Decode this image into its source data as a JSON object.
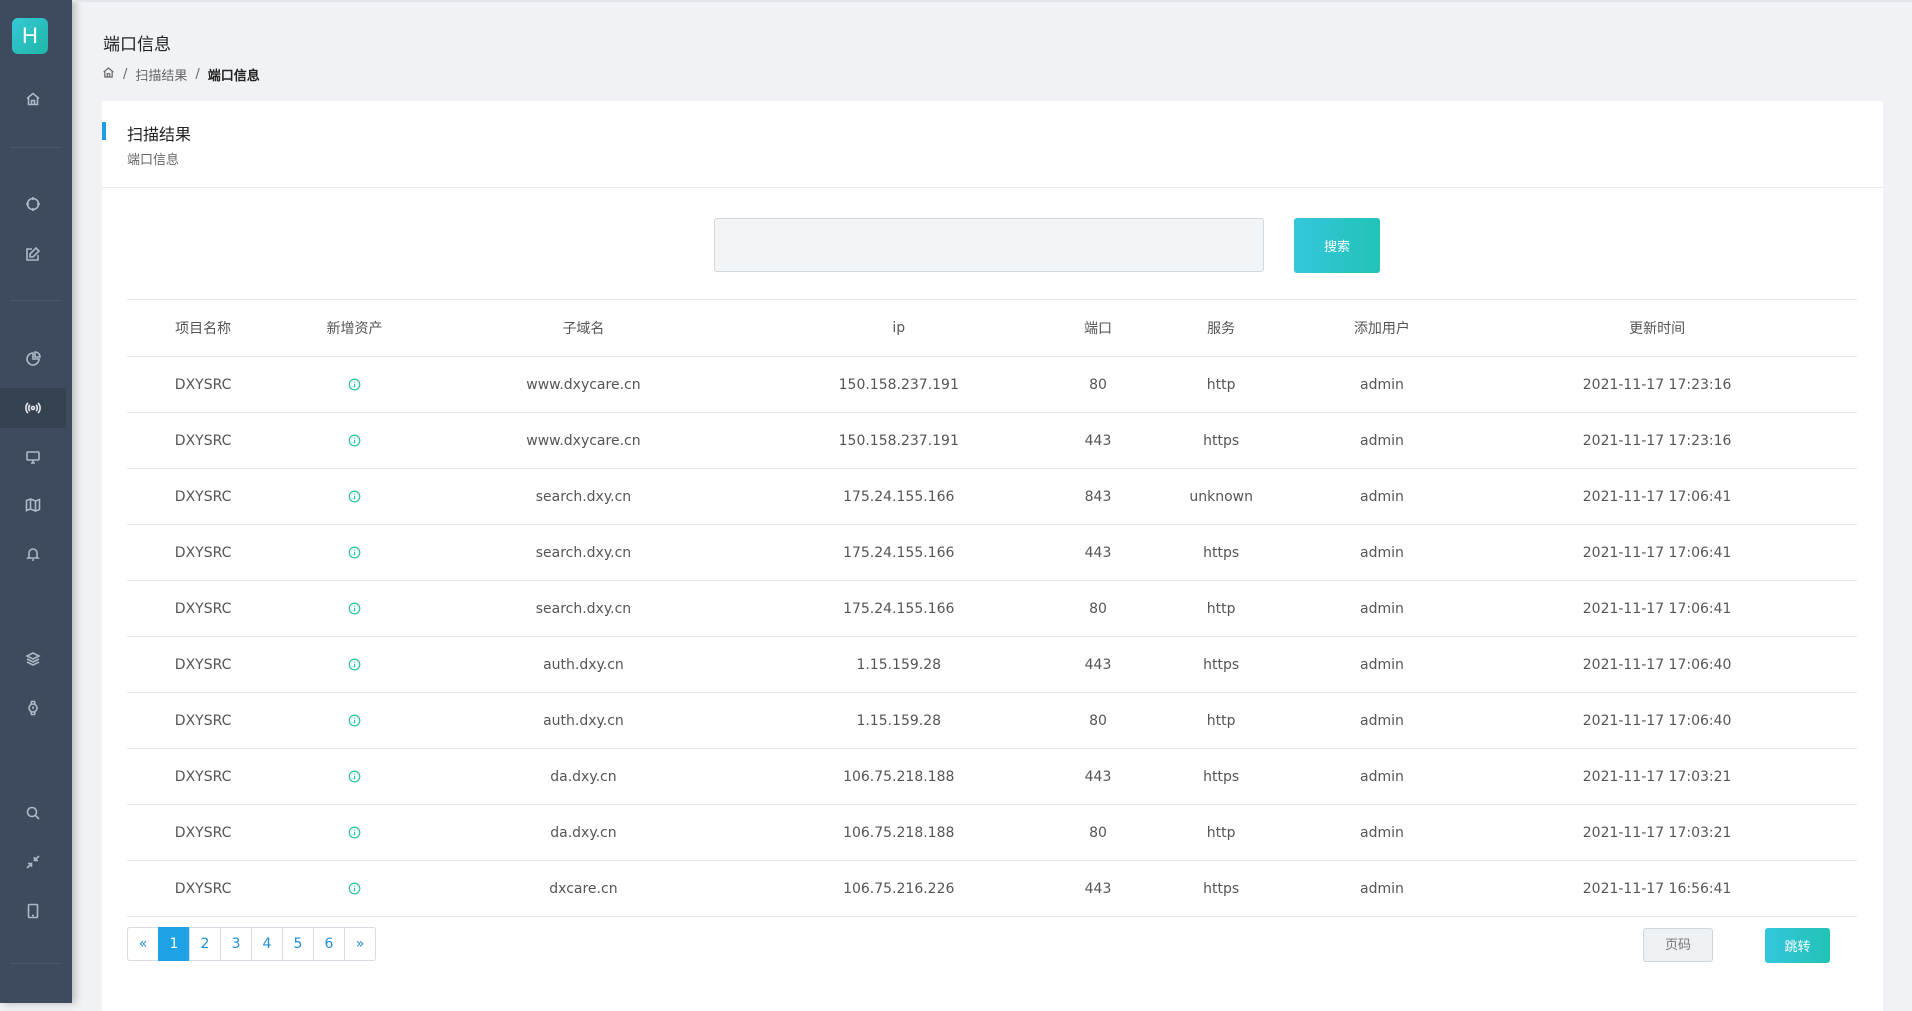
{
  "sidebar": {
    "logo_letter": "H",
    "active_item": "radio-icon"
  },
  "header": {
    "page_title": "端口信息",
    "breadcrumb": [
      "扫描结果",
      "端口信息"
    ],
    "breadcrumb_separator": "/"
  },
  "card": {
    "title": "扫描结果",
    "subtitle": "端口信息"
  },
  "search": {
    "value": "",
    "button_label": "搜索"
  },
  "table": {
    "columns": [
      "项目名称",
      "新增资产",
      "子域名",
      "ip",
      "端口",
      "服务",
      "添加用户",
      "更新时间"
    ],
    "rows": [
      [
        "DXYSRC",
        "",
        "www.dxycare.cn",
        "150.158.237.191",
        "80",
        "http",
        "admin",
        "2021-11-17 17:23:16"
      ],
      [
        "DXYSRC",
        "",
        "www.dxycare.cn",
        "150.158.237.191",
        "443",
        "https",
        "admin",
        "2021-11-17 17:23:16"
      ],
      [
        "DXYSRC",
        "",
        "search.dxy.cn",
        "175.24.155.166",
        "843",
        "unknown",
        "admin",
        "2021-11-17 17:06:41"
      ],
      [
        "DXYSRC",
        "",
        "search.dxy.cn",
        "175.24.155.166",
        "443",
        "https",
        "admin",
        "2021-11-17 17:06:41"
      ],
      [
        "DXYSRC",
        "",
        "search.dxy.cn",
        "175.24.155.166",
        "80",
        "http",
        "admin",
        "2021-11-17 17:06:41"
      ],
      [
        "DXYSRC",
        "",
        "auth.dxy.cn",
        "1.15.159.28",
        "443",
        "https",
        "admin",
        "2021-11-17 17:06:40"
      ],
      [
        "DXYSRC",
        "",
        "auth.dxy.cn",
        "1.15.159.28",
        "80",
        "http",
        "admin",
        "2021-11-17 17:06:40"
      ],
      [
        "DXYSRC",
        "",
        "da.dxy.cn",
        "106.75.218.188",
        "443",
        "https",
        "admin",
        "2021-11-17 17:03:21"
      ],
      [
        "DXYSRC",
        "",
        "da.dxy.cn",
        "106.75.218.188",
        "80",
        "http",
        "admin",
        "2021-11-17 17:03:21"
      ],
      [
        "DXYSRC",
        "",
        "dxcare.cn",
        "106.75.216.226",
        "443",
        "https",
        "admin",
        "2021-11-17 16:56:41"
      ]
    ],
    "status_icon": "info-circle-icon",
    "status_color": "#22c3a6"
  },
  "pagination": {
    "prev": "«",
    "pages": [
      "1",
      "2",
      "3",
      "4",
      "5",
      "6"
    ],
    "next": "»",
    "current": "1",
    "page_input_placeholder": "页码",
    "jump_label": "跳转"
  },
  "colors": {
    "accent": "#1e9ce6",
    "button": "#26c4c4",
    "sidebar": "#3e4b5e"
  }
}
